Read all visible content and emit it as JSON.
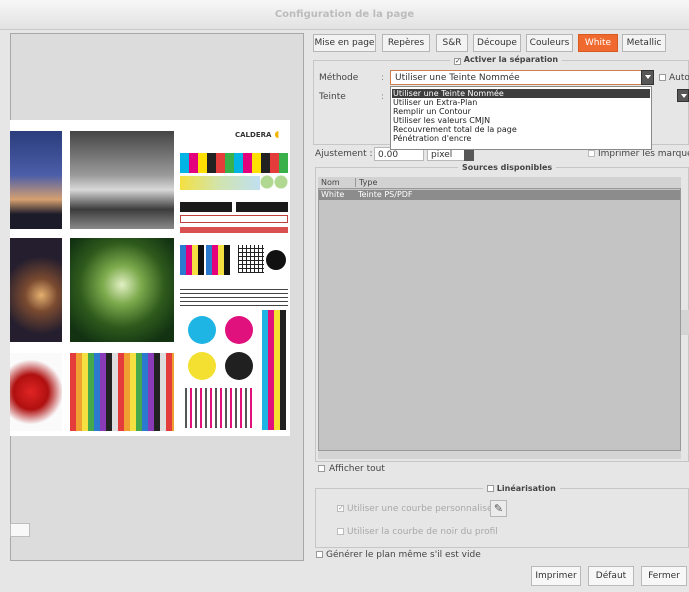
{
  "window": {
    "title": "Configuration de la page"
  },
  "tabs": [
    {
      "label": "Mise en page"
    },
    {
      "label": "Repères"
    },
    {
      "label": "S&R"
    },
    {
      "label": "Découpe"
    },
    {
      "label": "Couleurs"
    },
    {
      "label": "White"
    },
    {
      "label": "Metallic"
    }
  ],
  "active_tab": "White",
  "accent_color": "#f06a30",
  "preview": {
    "logo": "CALDERA"
  },
  "separation": {
    "activate_label": "Activer la séparation",
    "activate_checked": true,
    "method_label": "Méthode",
    "method_value": "Utiliser une Teinte Nommée",
    "auto_label": "Auto",
    "teinte_label": "Teinte",
    "options": [
      "Utiliser une Teinte Nommée",
      "Utiliser un Extra-Plan",
      "Remplir un Contour",
      "Utiliser les valeurs CMJN",
      "Recouvrement total de la page",
      "Pénétration d'encre"
    ],
    "adjust_label": "Ajustement :",
    "adjust_value": "0.00",
    "adjust_unit": "pixel",
    "print_marks_label": "Imprimer les marques"
  },
  "sources": {
    "title": "Sources disponibles",
    "columns": [
      "Nom",
      "Type"
    ],
    "rows": [
      {
        "name": "White",
        "type": "Teinte PS/PDF"
      }
    ],
    "show_all_label": "Afficher tout"
  },
  "linearisation": {
    "title": "Linéarisation",
    "custom_curve_label": "Utiliser une courbe personnalisée",
    "custom_curve_checked": true,
    "black_curve_label": "Utiliser la courbe de noir du profil"
  },
  "generate_empty_label": "Générer le plan même s'il est vide",
  "buttons": {
    "print": "Imprimer",
    "default": "Défaut",
    "close": "Fermer"
  }
}
